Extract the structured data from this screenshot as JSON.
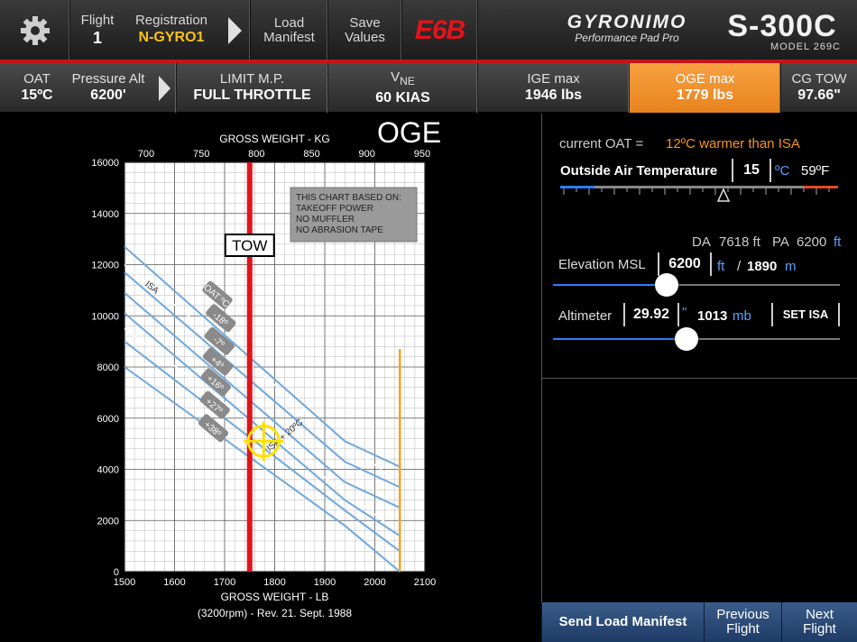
{
  "topbar": {
    "flight_label": "Flight",
    "flight_value": "1",
    "registration_label": "Registration",
    "registration_value": "N-GYRO1",
    "load_manifest_label": "Load Manifest",
    "save_values_label": "Save Values",
    "e6b_label": "E6B",
    "brand": "GYRONIMO",
    "brand_sub": "Performance Pad Pro",
    "model": "S-300C",
    "model_sub": "MODEL 269C"
  },
  "infobar": {
    "oat_label": "OAT",
    "oat_value": "15ºC",
    "pa_label": "Pressure Alt",
    "pa_value": "6200'",
    "limit_label": "LIMIT M.P.",
    "limit_value": "FULL THROTTLE",
    "vne_label": "V",
    "vne_sub": "NE",
    "vne_value": "60 KIAS",
    "ige_label": "IGE max",
    "ige_value": "1946 lbs",
    "oge_label": "OGE max",
    "oge_value": "1779 lbs",
    "cg_label": "CG TOW",
    "cg_value": "97.66\""
  },
  "chart_data": {
    "type": "line",
    "title": "OGE",
    "x_top_label": "GROSS WEIGHT - KG",
    "x_top_ticks": [
      "700",
      "750",
      "800",
      "850",
      "900",
      "950"
    ],
    "xlabel": "GROSS WEIGHT - LB",
    "x_ticks": [
      "1500",
      "1600",
      "1700",
      "1800",
      "1900",
      "2000",
      "2100"
    ],
    "y_ticks": [
      "0",
      "2000",
      "4000",
      "6000",
      "8000",
      "10000",
      "12000",
      "14000",
      "16000"
    ],
    "xlim": [
      1500,
      2100
    ],
    "ylim": [
      0,
      16000
    ],
    "footnote": "(3200rpm) - Rev. 21. Sept. 1988",
    "note_lines": [
      "THIS CHART BASED ON:",
      "TAKEOFF POWER",
      "NO MUFFLER",
      "NO ABRASION TAPE"
    ],
    "tow_label": "TOW",
    "tow_weight": 1750,
    "oge_limit_weight": 2050,
    "marker": {
      "x": 1778,
      "y": 5100
    },
    "oat_header": "OAT ºC",
    "isa_label": "ISA",
    "isa_plus_label": "ISA + 20ºC",
    "series": [
      {
        "name": "-18º",
        "points": [
          [
            1500,
            12700
          ],
          [
            1940,
            5100
          ],
          [
            2050,
            4100
          ]
        ]
      },
      {
        "name": "-7º",
        "points": [
          [
            1500,
            11700
          ],
          [
            1940,
            4300
          ],
          [
            2050,
            3300
          ]
        ]
      },
      {
        "name": "+4º",
        "points": [
          [
            1500,
            10900
          ],
          [
            1940,
            3500
          ],
          [
            2050,
            2500
          ]
        ]
      },
      {
        "name": "+16º",
        "points": [
          [
            1500,
            10100
          ],
          [
            1940,
            2800
          ],
          [
            2050,
            1400
          ]
        ]
      },
      {
        "name": "+27º",
        "points": [
          [
            1500,
            9000
          ],
          [
            1940,
            2400
          ],
          [
            2050,
            800
          ]
        ]
      },
      {
        "name": "+38º",
        "points": [
          [
            1500,
            8000
          ],
          [
            1940,
            1800
          ],
          [
            2050,
            0
          ]
        ]
      }
    ],
    "isa_line": [
      [
        1500,
        12000
      ],
      [
        2030,
        3700
      ]
    ],
    "isa20_line": [
      [
        1500,
        9500
      ],
      [
        2030,
        1800
      ]
    ]
  },
  "oat_panel": {
    "current_oat_label": "current OAT =",
    "current_oat_value": "12ºC warmer than ISA",
    "outside_air_label": "Outside Air Temperature",
    "temp_c": "15",
    "unit_c": "ºC",
    "temp_f": "59ºF",
    "da_label": "DA",
    "da_value": "7618 ft",
    "pa_label": "PA",
    "pa_value": "6200",
    "pa_unit": "ft",
    "elevation_label": "Elevation MSL",
    "elevation_ft": "6200",
    "elevation_ft_unit": "ft",
    "elevation_separator": "/",
    "elevation_m": "1890",
    "elevation_m_unit": "m",
    "altimeter_label": "Altimeter",
    "altimeter_value": "29.92",
    "altimeter_unit": "\"",
    "altimeter_mb": "1013",
    "altimeter_mb_unit": "mb",
    "set_isa_label": "SET ISA"
  },
  "bottom": {
    "send_label": "Send Load Manifest",
    "prev_label": "Previous Flight",
    "next_label": "Next Flight"
  },
  "colors": {
    "accent_orange": "#f7941d",
    "tow_red": "#e0141a",
    "curve_blue": "#6fa8dc",
    "marker_yellow": "#ffe100",
    "slider_blue": "#2d7bff"
  }
}
